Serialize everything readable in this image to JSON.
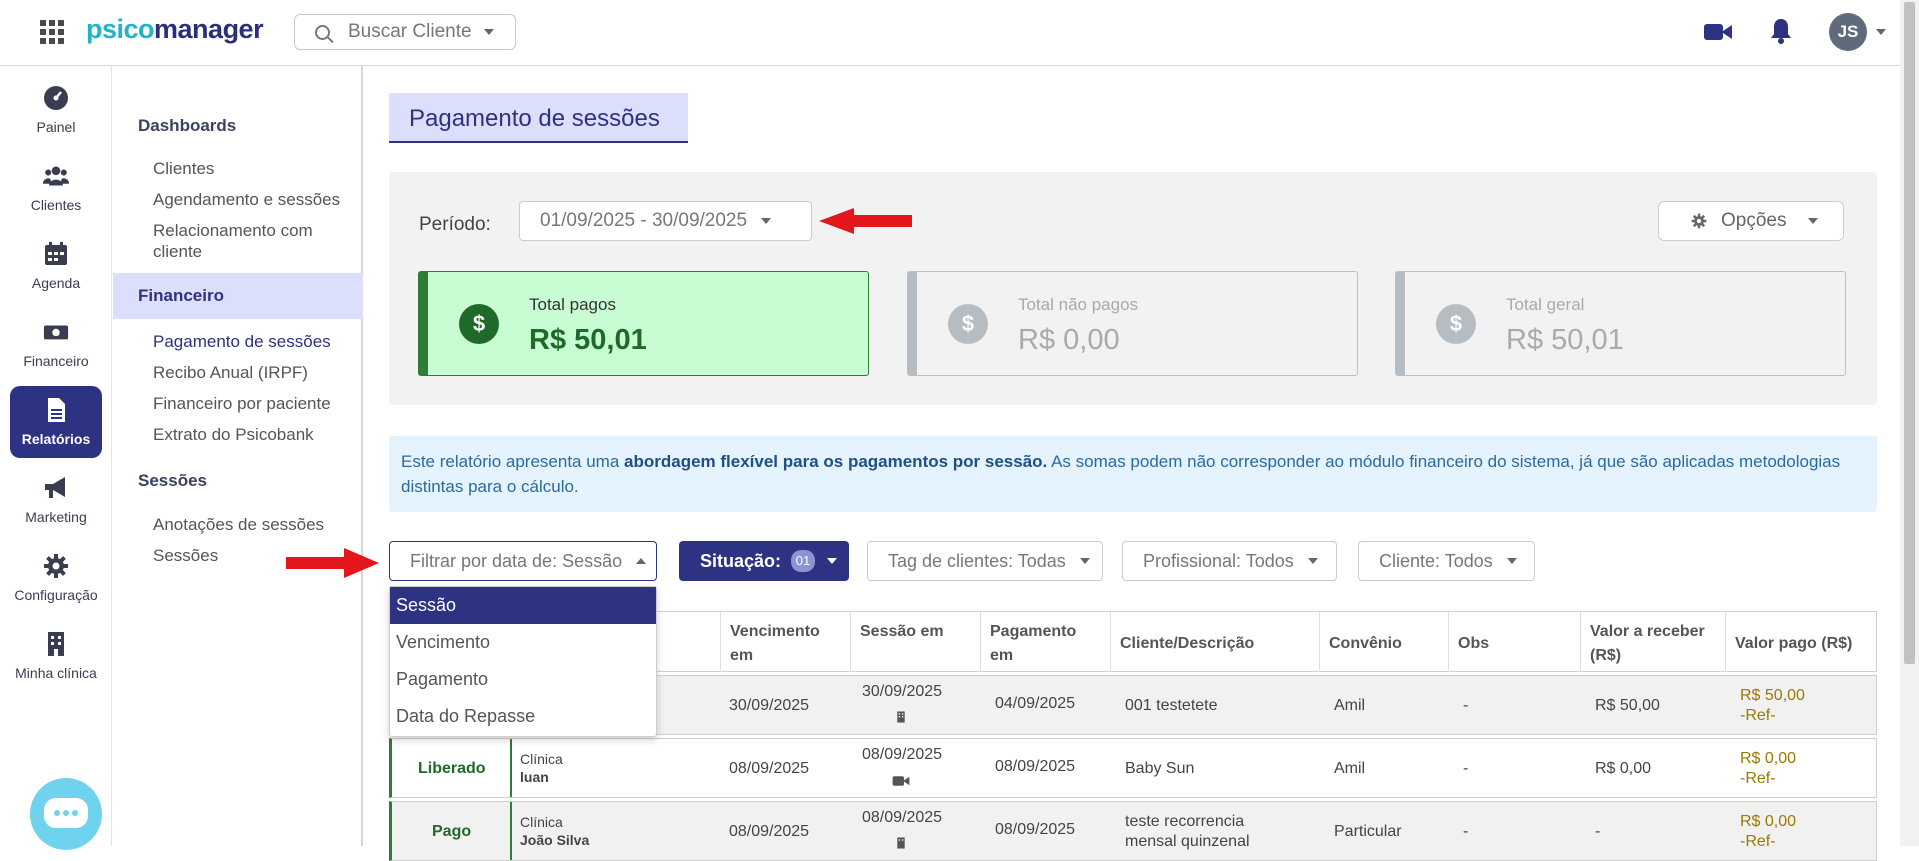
{
  "brand": {
    "part1": "psico",
    "part2": "manager"
  },
  "search": {
    "placeholder": "Buscar Cliente"
  },
  "user": {
    "initials": "JS"
  },
  "rail": [
    {
      "label": "Painel"
    },
    {
      "label": "Clientes"
    },
    {
      "label": "Agenda"
    },
    {
      "label": "Financeiro"
    },
    {
      "label": "Relatórios"
    },
    {
      "label": "Marketing"
    },
    {
      "label": "Configuração"
    },
    {
      "label": "Minha clínica"
    }
  ],
  "submenu": {
    "dashboards": {
      "title": "Dashboards",
      "items": [
        "Clientes",
        "Agendamento e sessões",
        "Relacionamento com cliente"
      ]
    },
    "financeiro": {
      "title": "Financeiro",
      "items": [
        "Pagamento de sessões",
        "Recibo Anual (IRPF)",
        "Financeiro por paciente",
        "Extrato do Psicobank"
      ]
    },
    "sessoes": {
      "title": "Sessões",
      "items": [
        "Anotações de sessões",
        "Sessões"
      ]
    }
  },
  "page": {
    "title": "Pagamento de sessões"
  },
  "period": {
    "label": "Período:",
    "value": "01/09/2025 - 30/09/2025"
  },
  "options": {
    "label": "Opções"
  },
  "cards": [
    {
      "label": "Total pagos",
      "value": "R$ 50,01",
      "symbol": "$"
    },
    {
      "label": "Total não pagos",
      "value": "R$ 0,00",
      "symbol": "$"
    },
    {
      "label": "Total geral",
      "value": "R$ 50,01",
      "symbol": "$"
    }
  ],
  "info": {
    "pre": "Este relatório apresenta uma ",
    "bold": "abordagem flexível para os pagamentos por sessão.",
    "post": " As somas podem não corresponder ao módulo financeiro do sistema, já que são aplicadas metodologias distintas para o cálculo."
  },
  "filters": {
    "date": "Filtrar por data de: Sessão",
    "situacao": "Situação:",
    "situacao_count": "01",
    "tags": "Tag de clientes: Todas",
    "profissional": "Profissional: Todos",
    "cliente": "Cliente: Todos"
  },
  "date_dropdown": {
    "options": [
      "Sessão",
      "Vencimento",
      "Pagamento",
      "Data do Repasse"
    ],
    "selected": "Sessão"
  },
  "table": {
    "headers": {
      "vencimento": "Vencimento em",
      "sessao": "Sessão em",
      "pagamento": "Pagamento em",
      "cliente": "Cliente/Descrição",
      "convenio": "Convênio",
      "obs": "Obs",
      "valor_receber": "Valor a receber (R$)",
      "valor_pago": "Valor pago (R$)"
    },
    "rows": [
      {
        "status": "",
        "local": "",
        "profissional": "",
        "vencimento": "30/09/2025",
        "sessao": "30/09/2025",
        "sessao_icon": "building-icon",
        "pagamento": "04/09/2025",
        "cliente": "001 testetete",
        "convenio": "Amil",
        "obs": "-",
        "valor_receber": "R$ 50,00",
        "valor_pago": "R$ 50,00",
        "ref": "-Ref-"
      },
      {
        "status": "Liberado",
        "local": "Clínica",
        "profissional": "luan",
        "vencimento": "08/09/2025",
        "sessao": "08/09/2025",
        "sessao_icon": "video-icon",
        "pagamento": "08/09/2025",
        "cliente": "Baby Sun",
        "convenio": "Amil",
        "obs": "-",
        "valor_receber": "R$ 0,00",
        "valor_pago": "R$ 0,00",
        "ref": "-Ref-"
      },
      {
        "status": "Pago",
        "local": "Clínica",
        "profissional": "João Silva",
        "vencimento": "08/09/2025",
        "sessao": "08/09/2025",
        "sessao_icon": "building-icon",
        "pagamento": "08/09/2025",
        "cliente": "teste recorrencia mensal quinzenal",
        "convenio": "Particular",
        "obs": "-",
        "valor_receber": "-",
        "valor_pago": "R$ 0,00",
        "ref": "-Ref-"
      }
    ]
  },
  "colors": {
    "primary": "#2d3282",
    "green": "#2e7d32",
    "accent_cyan": "#22b3c9",
    "info_bg": "#e5f3ff",
    "arrow_red": "#e3161c"
  }
}
